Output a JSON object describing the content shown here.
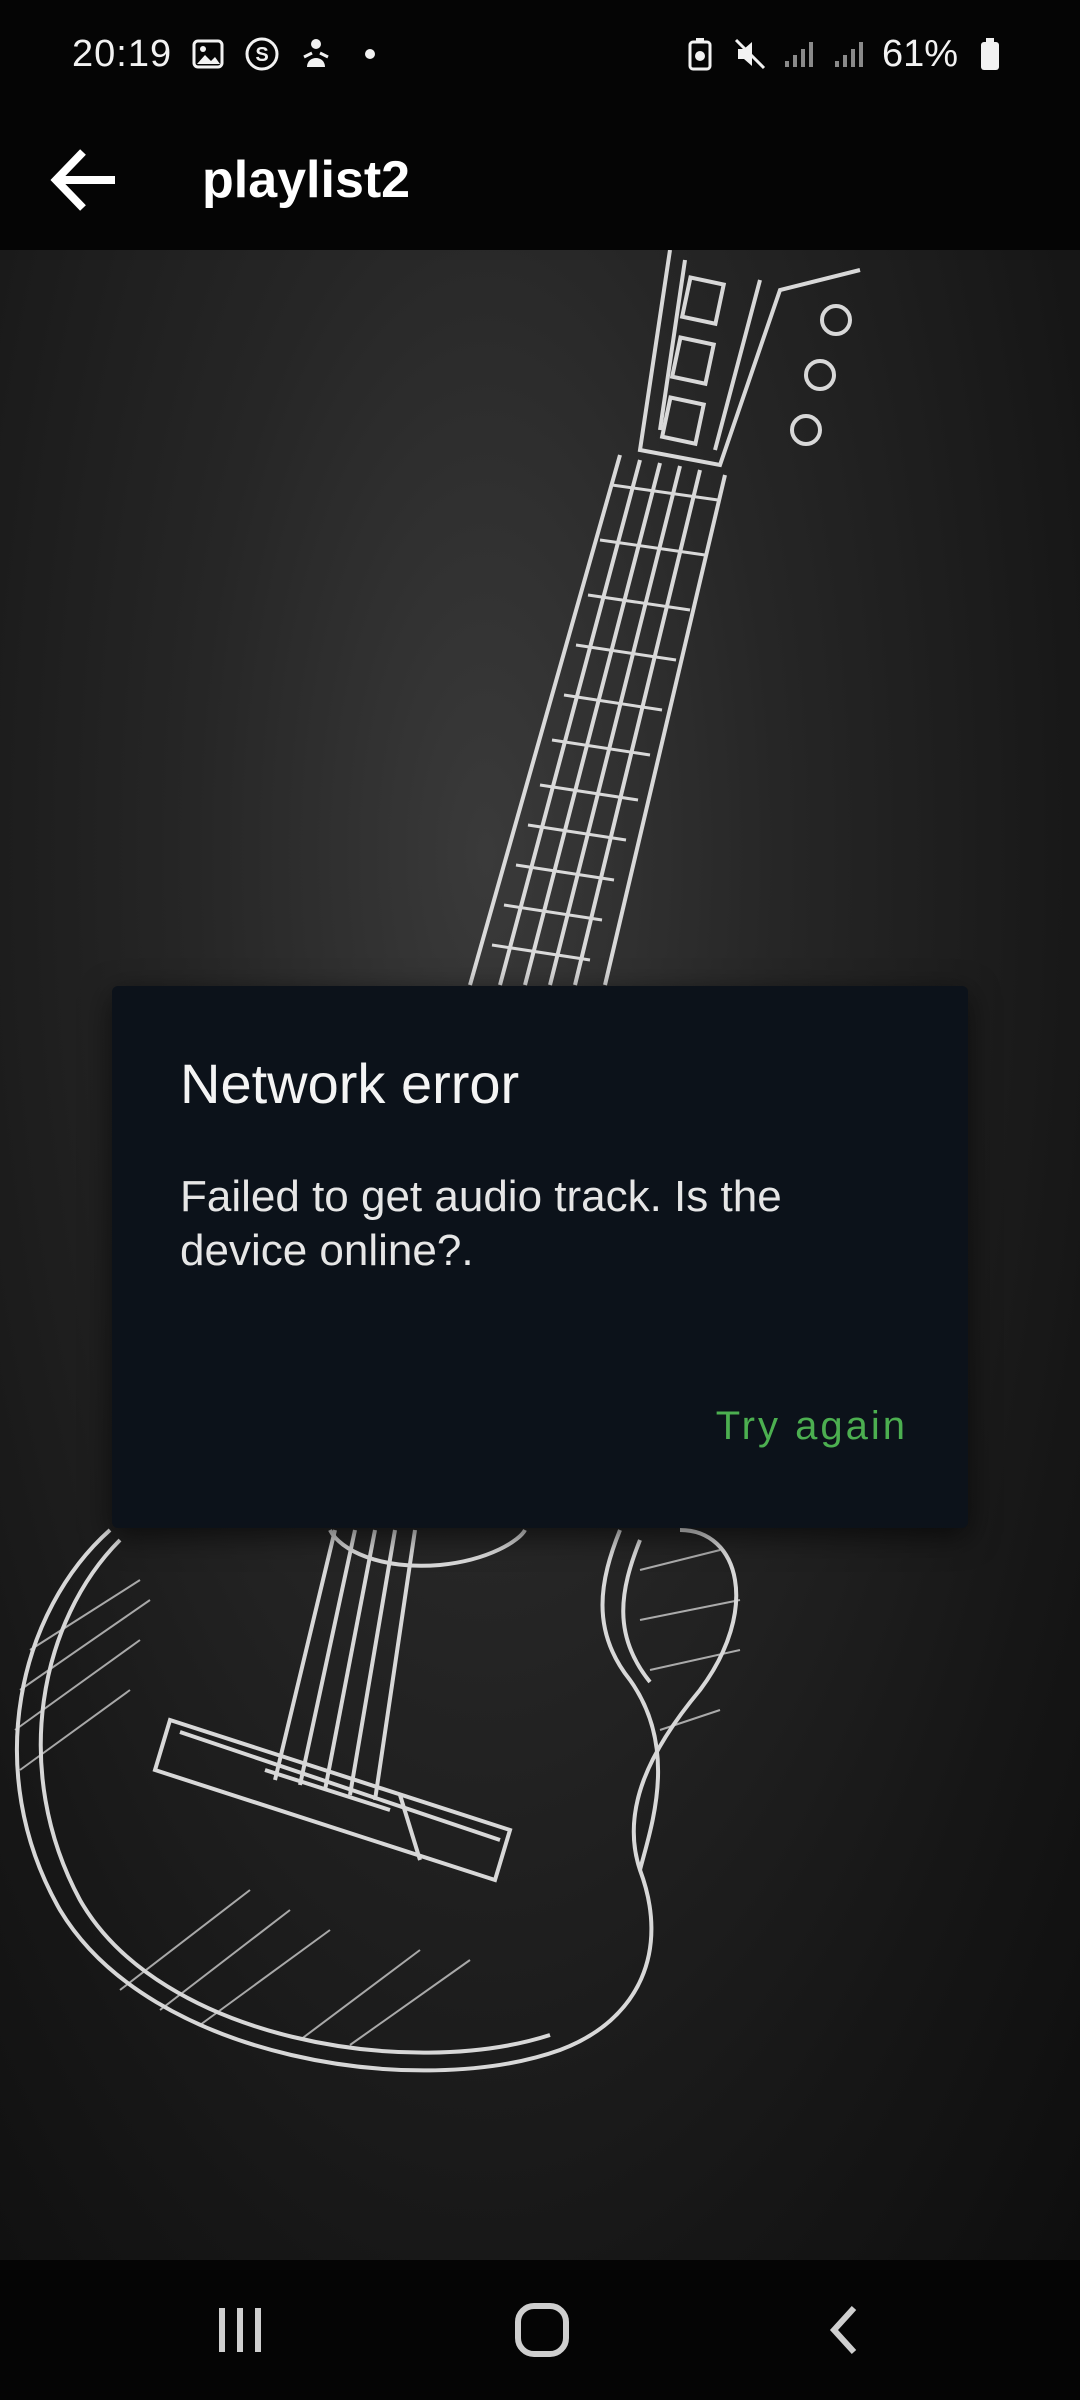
{
  "status_bar": {
    "time": "20:19",
    "notification_icons": [
      "gallery-icon",
      "s-circle-icon",
      "person-icon",
      "dot-icon"
    ],
    "system_icons": [
      "battery-saver-icon",
      "mute-icon",
      "signal-icon",
      "signal-icon"
    ],
    "battery_percent": "61%"
  },
  "app_bar": {
    "title": "playlist2",
    "back_icon": "arrow-left-icon"
  },
  "dialog": {
    "title": "Network error",
    "message": "Failed to get audio track. Is the device online?.",
    "action_label": "Try again",
    "action_color": "#4caf50"
  },
  "nav_bar": {
    "items": [
      "recents-icon",
      "home-icon",
      "back-icon"
    ]
  }
}
